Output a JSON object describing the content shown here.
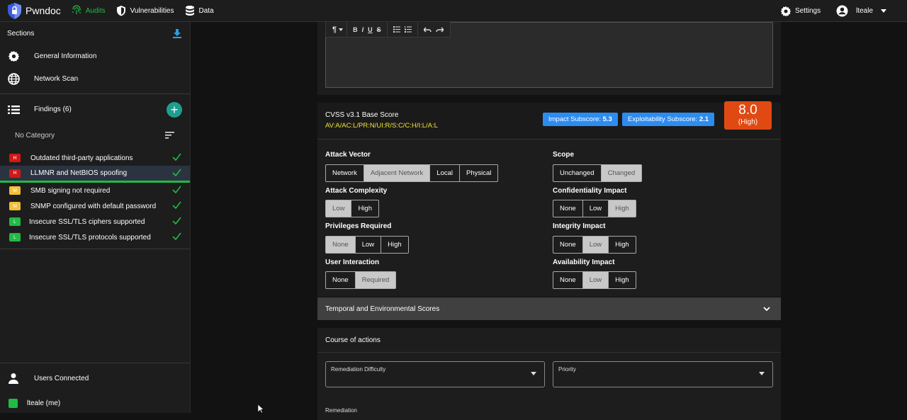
{
  "topbar": {
    "brand": "Pwndoc",
    "nav": [
      {
        "label": "Audits",
        "icon": "fingerprint-icon",
        "active": true
      },
      {
        "label": "Vulnerabilities",
        "icon": "shield-icon"
      },
      {
        "label": "Data",
        "icon": "database-icon"
      }
    ],
    "settings_label": "Settings",
    "user_label": "lteale"
  },
  "sidebar": {
    "sections_label": "Sections",
    "general_information": "General Information",
    "network_scan": "Network Scan",
    "findings_label": "Findings (6)",
    "no_category": "No Category",
    "findings": [
      {
        "severity": "H",
        "title": "Outdated third-party applications"
      },
      {
        "severity": "H",
        "title": "LLMNR and NetBIOS spoofing"
      },
      {
        "severity": "M",
        "title": "SMB signing not required"
      },
      {
        "severity": "M",
        "title": "SNMP configured with default password"
      },
      {
        "severity": "L",
        "title": "Insecure SSL/TLS ciphers supported"
      },
      {
        "severity": "L",
        "title": "Insecure SSL/TLS protocols supported"
      }
    ],
    "users_connected": "Users Connected",
    "current_user": "lteale (me)"
  },
  "editor": {
    "toolbar": [
      "¶",
      "B",
      "I",
      "U",
      "S"
    ]
  },
  "cvss": {
    "title": "CVSS v3.1 Base Score",
    "vector": "AV:A/AC:L/PR:N/UI:R/S:C/C:H/I:L/A:L",
    "impact_label": "Impact Subscore:",
    "impact_value": "5.3",
    "exploit_label": "Exploitability Subscore:",
    "exploit_value": "2.1",
    "score": "8.0",
    "severity": "(High)",
    "metrics": {
      "attack_vector": {
        "label": "Attack Vector",
        "options": [
          "Network",
          "Adjacent Network",
          "Local",
          "Physical"
        ],
        "selected": "Adjacent Network"
      },
      "attack_complexity": {
        "label": "Attack Complexity",
        "options": [
          "Low",
          "High"
        ],
        "selected": "Low"
      },
      "privileges_required": {
        "label": "Privileges Required",
        "options": [
          "None",
          "Low",
          "High"
        ],
        "selected": "None"
      },
      "user_interaction": {
        "label": "User Interaction",
        "options": [
          "None",
          "Required"
        ],
        "selected": "Required"
      },
      "scope": {
        "label": "Scope",
        "options": [
          "Unchanged",
          "Changed"
        ],
        "selected": "Changed"
      },
      "confidentiality": {
        "label": "Confidentiality Impact",
        "options": [
          "None",
          "Low",
          "High"
        ],
        "selected": "High"
      },
      "integrity": {
        "label": "Integrity Impact",
        "options": [
          "None",
          "Low",
          "High"
        ],
        "selected": "Low"
      },
      "availability": {
        "label": "Availability Impact",
        "options": [
          "None",
          "Low",
          "High"
        ],
        "selected": "Low"
      }
    }
  },
  "temporal_label": "Temporal and Environmental Scores",
  "course": {
    "title": "Course of actions",
    "remediation_difficulty": "Remediation Difficulty",
    "priority": "Priority",
    "remediation": "Remediation"
  },
  "colors": {
    "accent": "#21ba45",
    "score": "#e04a12",
    "badge": "#2d8cf0",
    "vector": "#f2e635"
  }
}
